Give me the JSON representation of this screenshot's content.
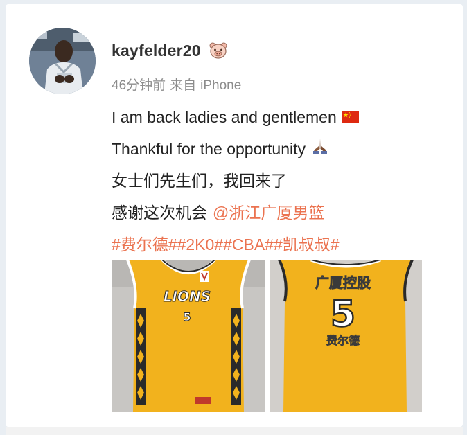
{
  "post": {
    "username": "kayfelder20",
    "badge_icon": "pig-face-icon",
    "time": "46分钟前",
    "source_prefix": "来自",
    "source": "iPhone",
    "lines": [
      "I am back ladies and gentlemen",
      "Thankful for the opportunity",
      "女士们先生们，我回来了",
      "感谢这次机会"
    ],
    "line1_icon": "china-flag-icon",
    "line2_icon": "praying-hands-icon",
    "mention": "@浙江广厦男篮",
    "hashtags": "#费尔德##2K0##CBA##凯叔叔#"
  },
  "photos": [
    {
      "name": "jersey-lions-photo",
      "jersey_text": "LIONS",
      "number": "5"
    },
    {
      "name": "jersey-back-photo",
      "sponsor_text": "广厦控股",
      "number": "5",
      "player_name": "费尔德"
    }
  ],
  "colors": {
    "link": "#eb7350",
    "jersey_yellow": "#f2b21d",
    "text": "#222222",
    "meta": "#8c8c8c"
  }
}
